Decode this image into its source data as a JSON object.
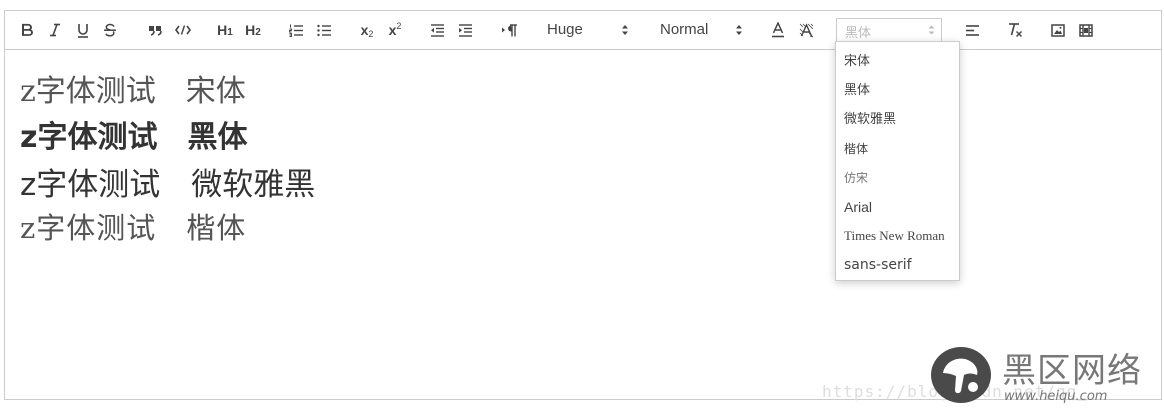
{
  "toolbar": {
    "size_picker": "Huge",
    "header_picker": "Normal",
    "font_picker_selected": "黑体",
    "header1_label": "H",
    "header1_sub": "1",
    "header2_label": "H",
    "header2_sub": "2",
    "subscript_base": "x",
    "subscript_sub": "2",
    "superscript_base": "x",
    "superscript_sup": "2"
  },
  "font_dropdown": {
    "options": [
      "宋体",
      "黑体",
      "微软雅黑",
      "楷体",
      "仿宋",
      "Arial",
      "Times New Roman",
      "sans-serif"
    ]
  },
  "content": {
    "lines": [
      "z字体测试　宋体",
      "z字体测试　黑体",
      "z字体测试　微软雅黑",
      "z字体测试　楷体"
    ]
  },
  "watermark": {
    "url": "https://blog.csdn.net/qq_"
  },
  "brand": {
    "name": "黑区网络",
    "url": "www.heiqu.com"
  },
  "colors": {
    "border": "#cccccc",
    "icon": "#444444",
    "placeholder": "#bbbbbb",
    "logo_dark": "#4a4a4a"
  }
}
